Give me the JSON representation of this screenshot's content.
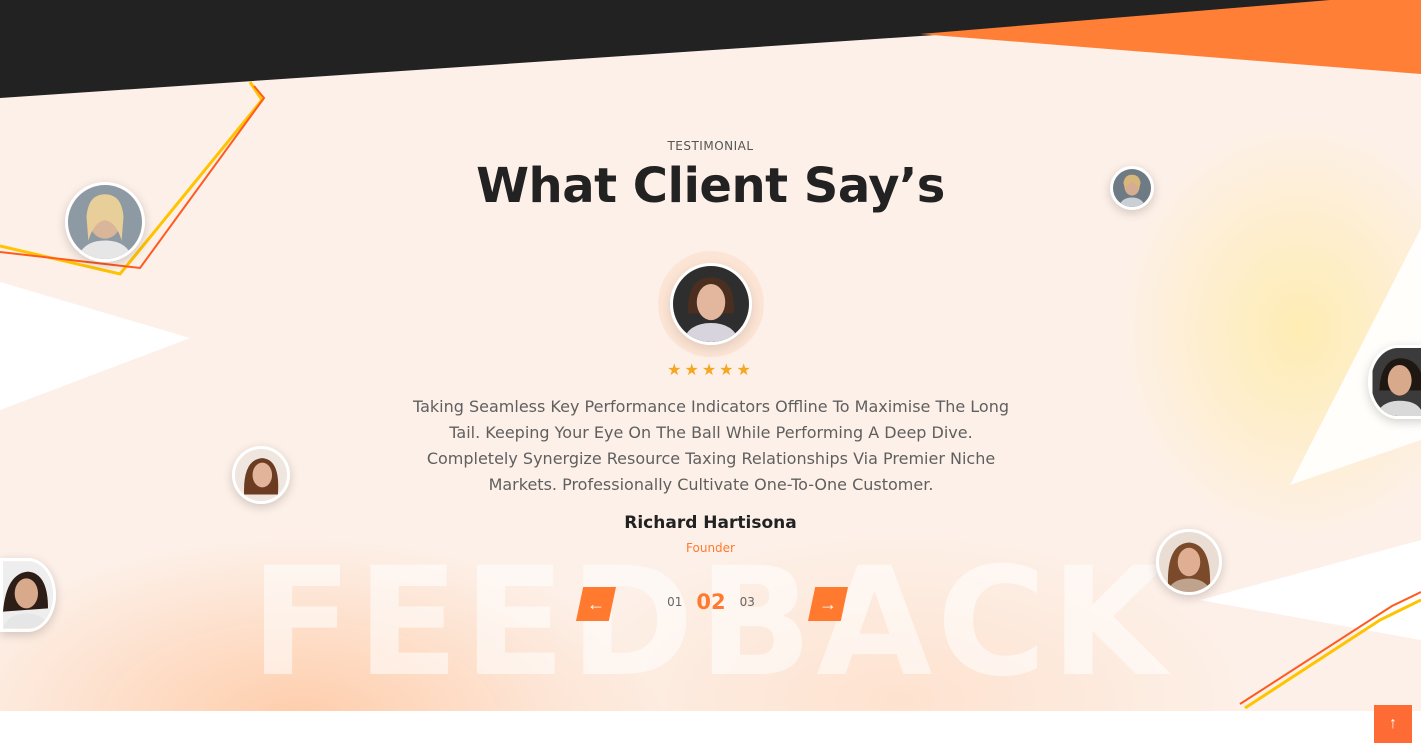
{
  "section": {
    "eyebrow": "TESTIMONIAL",
    "title": "What Client Say’s",
    "watermark": "FEEDBACK"
  },
  "testimonial": {
    "rating": 5,
    "stars": "★★★★★",
    "quote": "Taking Seamless Key Performance Indicators Offline To Maximise The Long Tail. Keeping Your Eye On The Ball While Performing A Deep Dive. Completely Synergize Resource Taxing Relationships Via Premier Niche Markets. Professionally Cultivate One-To-One Customer.",
    "name": "Richard Hartisona",
    "role": "Founder"
  },
  "pager": {
    "prev": "01",
    "current": "02",
    "next": "03"
  },
  "icons": {
    "prev": "←",
    "next": "→",
    "scroll_top": "↑"
  },
  "colors": {
    "accent": "#ff7a2f",
    "dark": "#222222",
    "background": "#fdf0e8",
    "star": "#f5a623"
  }
}
